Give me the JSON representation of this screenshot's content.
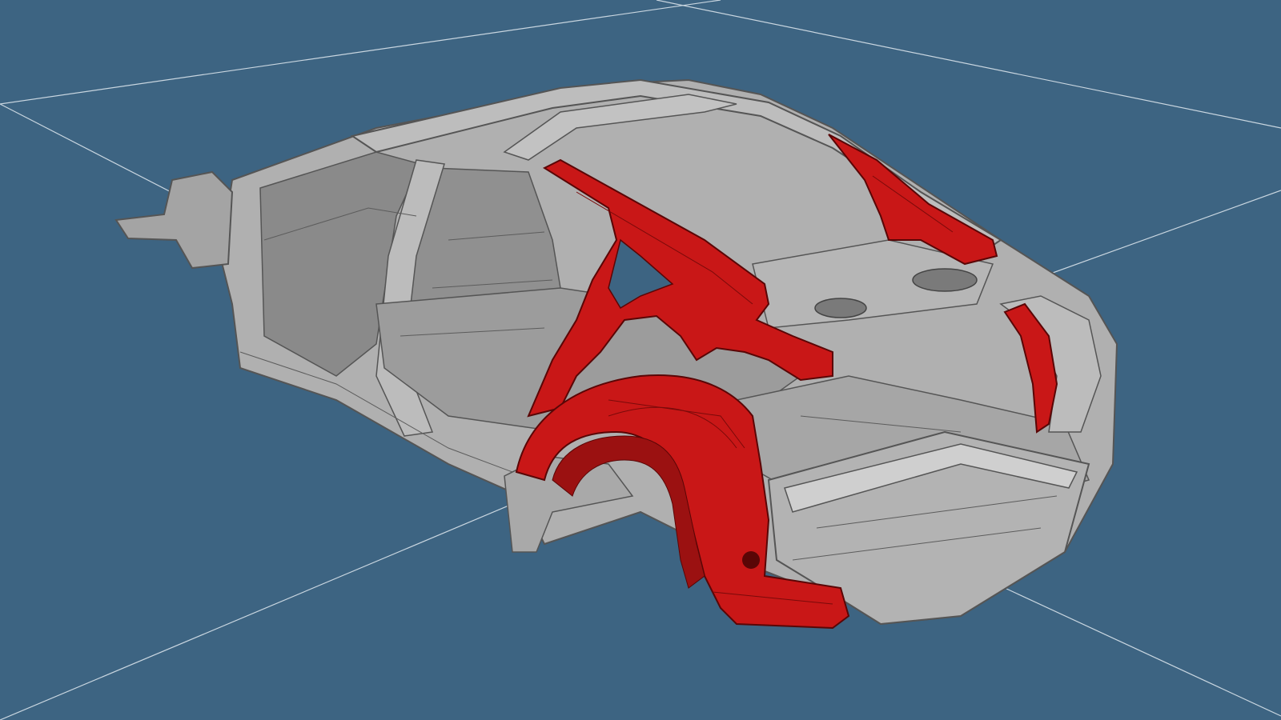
{
  "viewport": {
    "background": "#3d6482",
    "grid_color": "#c9d6e0",
    "body_color": "#a9a9a9",
    "body_dark": "#6e6e6e",
    "highlight_color": "#c91717",
    "highlight_dark": "#8f0d0d"
  },
  "model": {
    "icon": "car-body-in-white-icon",
    "highlighted_parts": [
      "rear-quarter-panel-inner",
      "c-pillar",
      "rear-wheel-arch",
      "d-pillar-inner-right"
    ]
  }
}
